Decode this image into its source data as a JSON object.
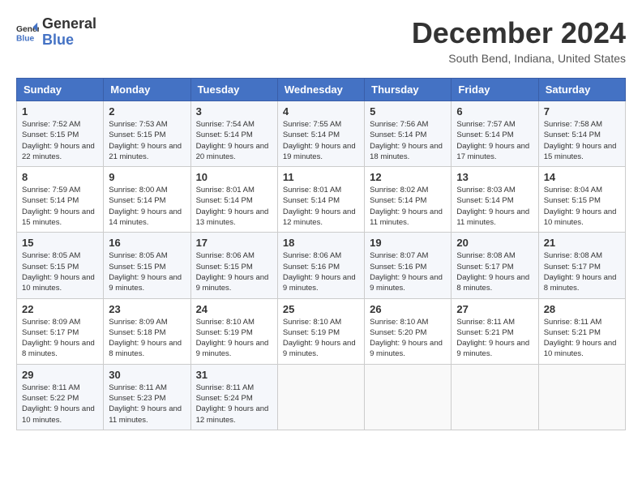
{
  "logo": {
    "line1": "General",
    "line2": "Blue"
  },
  "header": {
    "month": "December 2024",
    "location": "South Bend, Indiana, United States"
  },
  "days_of_week": [
    "Sunday",
    "Monday",
    "Tuesday",
    "Wednesday",
    "Thursday",
    "Friday",
    "Saturday"
  ],
  "weeks": [
    [
      {
        "day": "1",
        "sunrise": "Sunrise: 7:52 AM",
        "sunset": "Sunset: 5:15 PM",
        "daylight": "Daylight: 9 hours and 22 minutes."
      },
      {
        "day": "2",
        "sunrise": "Sunrise: 7:53 AM",
        "sunset": "Sunset: 5:15 PM",
        "daylight": "Daylight: 9 hours and 21 minutes."
      },
      {
        "day": "3",
        "sunrise": "Sunrise: 7:54 AM",
        "sunset": "Sunset: 5:14 PM",
        "daylight": "Daylight: 9 hours and 20 minutes."
      },
      {
        "day": "4",
        "sunrise": "Sunrise: 7:55 AM",
        "sunset": "Sunset: 5:14 PM",
        "daylight": "Daylight: 9 hours and 19 minutes."
      },
      {
        "day": "5",
        "sunrise": "Sunrise: 7:56 AM",
        "sunset": "Sunset: 5:14 PM",
        "daylight": "Daylight: 9 hours and 18 minutes."
      },
      {
        "day": "6",
        "sunrise": "Sunrise: 7:57 AM",
        "sunset": "Sunset: 5:14 PM",
        "daylight": "Daylight: 9 hours and 17 minutes."
      },
      {
        "day": "7",
        "sunrise": "Sunrise: 7:58 AM",
        "sunset": "Sunset: 5:14 PM",
        "daylight": "Daylight: 9 hours and 15 minutes."
      }
    ],
    [
      {
        "day": "8",
        "sunrise": "Sunrise: 7:59 AM",
        "sunset": "Sunset: 5:14 PM",
        "daylight": "Daylight: 9 hours and 15 minutes."
      },
      {
        "day": "9",
        "sunrise": "Sunrise: 8:00 AM",
        "sunset": "Sunset: 5:14 PM",
        "daylight": "Daylight: 9 hours and 14 minutes."
      },
      {
        "day": "10",
        "sunrise": "Sunrise: 8:01 AM",
        "sunset": "Sunset: 5:14 PM",
        "daylight": "Daylight: 9 hours and 13 minutes."
      },
      {
        "day": "11",
        "sunrise": "Sunrise: 8:01 AM",
        "sunset": "Sunset: 5:14 PM",
        "daylight": "Daylight: 9 hours and 12 minutes."
      },
      {
        "day": "12",
        "sunrise": "Sunrise: 8:02 AM",
        "sunset": "Sunset: 5:14 PM",
        "daylight": "Daylight: 9 hours and 11 minutes."
      },
      {
        "day": "13",
        "sunrise": "Sunrise: 8:03 AM",
        "sunset": "Sunset: 5:14 PM",
        "daylight": "Daylight: 9 hours and 11 minutes."
      },
      {
        "day": "14",
        "sunrise": "Sunrise: 8:04 AM",
        "sunset": "Sunset: 5:15 PM",
        "daylight": "Daylight: 9 hours and 10 minutes."
      }
    ],
    [
      {
        "day": "15",
        "sunrise": "Sunrise: 8:05 AM",
        "sunset": "Sunset: 5:15 PM",
        "daylight": "Daylight: 9 hours and 10 minutes."
      },
      {
        "day": "16",
        "sunrise": "Sunrise: 8:05 AM",
        "sunset": "Sunset: 5:15 PM",
        "daylight": "Daylight: 9 hours and 9 minutes."
      },
      {
        "day": "17",
        "sunrise": "Sunrise: 8:06 AM",
        "sunset": "Sunset: 5:15 PM",
        "daylight": "Daylight: 9 hours and 9 minutes."
      },
      {
        "day": "18",
        "sunrise": "Sunrise: 8:06 AM",
        "sunset": "Sunset: 5:16 PM",
        "daylight": "Daylight: 9 hours and 9 minutes."
      },
      {
        "day": "19",
        "sunrise": "Sunrise: 8:07 AM",
        "sunset": "Sunset: 5:16 PM",
        "daylight": "Daylight: 9 hours and 9 minutes."
      },
      {
        "day": "20",
        "sunrise": "Sunrise: 8:08 AM",
        "sunset": "Sunset: 5:17 PM",
        "daylight": "Daylight: 9 hours and 8 minutes."
      },
      {
        "day": "21",
        "sunrise": "Sunrise: 8:08 AM",
        "sunset": "Sunset: 5:17 PM",
        "daylight": "Daylight: 9 hours and 8 minutes."
      }
    ],
    [
      {
        "day": "22",
        "sunrise": "Sunrise: 8:09 AM",
        "sunset": "Sunset: 5:17 PM",
        "daylight": "Daylight: 9 hours and 8 minutes."
      },
      {
        "day": "23",
        "sunrise": "Sunrise: 8:09 AM",
        "sunset": "Sunset: 5:18 PM",
        "daylight": "Daylight: 9 hours and 8 minutes."
      },
      {
        "day": "24",
        "sunrise": "Sunrise: 8:10 AM",
        "sunset": "Sunset: 5:19 PM",
        "daylight": "Daylight: 9 hours and 9 minutes."
      },
      {
        "day": "25",
        "sunrise": "Sunrise: 8:10 AM",
        "sunset": "Sunset: 5:19 PM",
        "daylight": "Daylight: 9 hours and 9 minutes."
      },
      {
        "day": "26",
        "sunrise": "Sunrise: 8:10 AM",
        "sunset": "Sunset: 5:20 PM",
        "daylight": "Daylight: 9 hours and 9 minutes."
      },
      {
        "day": "27",
        "sunrise": "Sunrise: 8:11 AM",
        "sunset": "Sunset: 5:21 PM",
        "daylight": "Daylight: 9 hours and 9 minutes."
      },
      {
        "day": "28",
        "sunrise": "Sunrise: 8:11 AM",
        "sunset": "Sunset: 5:21 PM",
        "daylight": "Daylight: 9 hours and 10 minutes."
      }
    ],
    [
      {
        "day": "29",
        "sunrise": "Sunrise: 8:11 AM",
        "sunset": "Sunset: 5:22 PM",
        "daylight": "Daylight: 9 hours and 10 minutes."
      },
      {
        "day": "30",
        "sunrise": "Sunrise: 8:11 AM",
        "sunset": "Sunset: 5:23 PM",
        "daylight": "Daylight: 9 hours and 11 minutes."
      },
      {
        "day": "31",
        "sunrise": "Sunrise: 8:11 AM",
        "sunset": "Sunset: 5:24 PM",
        "daylight": "Daylight: 9 hours and 12 minutes."
      },
      null,
      null,
      null,
      null
    ]
  ]
}
